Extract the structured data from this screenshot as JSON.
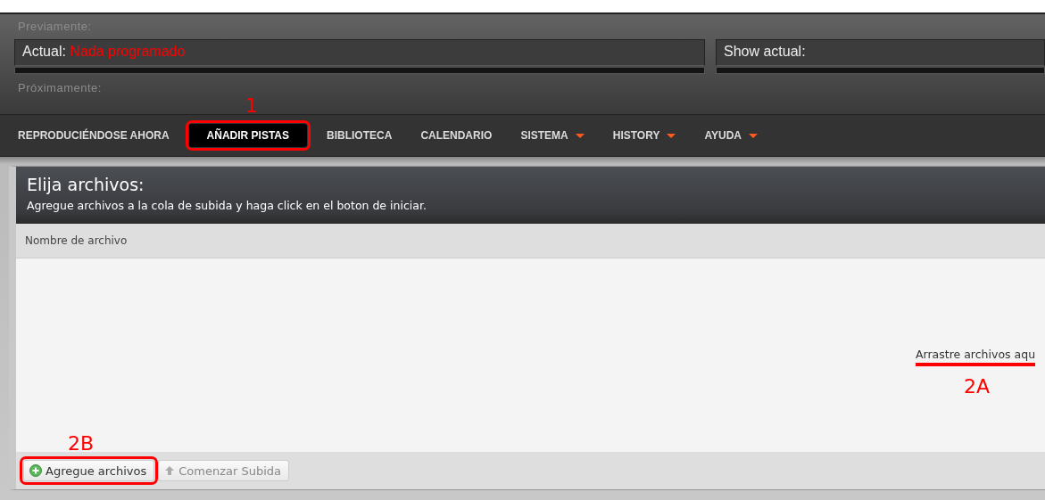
{
  "header": {
    "previous_label": "Previamente:",
    "current": {
      "label": "Actual:",
      "value": "Nada programado"
    },
    "show": {
      "label": "Show actual:"
    },
    "next_label": "Próximamente:"
  },
  "nav": [
    {
      "label": "REPRODUCIÉNDOSE AHORA",
      "selected": false,
      "dropdown": false
    },
    {
      "label": "AÑADIR PISTAS",
      "selected": true,
      "dropdown": false,
      "annotation": "1"
    },
    {
      "label": "BIBLIOTECA",
      "selected": false,
      "dropdown": false
    },
    {
      "label": "CALENDARIO",
      "selected": false,
      "dropdown": false
    },
    {
      "label": "SISTEMA",
      "selected": false,
      "dropdown": true
    },
    {
      "label": "HISTORY",
      "selected": false,
      "dropdown": true
    },
    {
      "label": "AYUDA",
      "selected": false,
      "dropdown": true
    }
  ],
  "uploader": {
    "title": "Elija archivos:",
    "subtitle": "Agregue archivos a la cola de subida y haga click en el boton de iniciar.",
    "column": "Nombre de archivo",
    "drop_hint": "Arrastre archivos aqu",
    "drop_annotation": "2A",
    "buttons": [
      {
        "label": "Agregue archivos",
        "kind": "add",
        "disabled": false,
        "annotation": "2B"
      },
      {
        "label": "Comenzar Subida",
        "kind": "upload",
        "disabled": true
      }
    ]
  }
}
